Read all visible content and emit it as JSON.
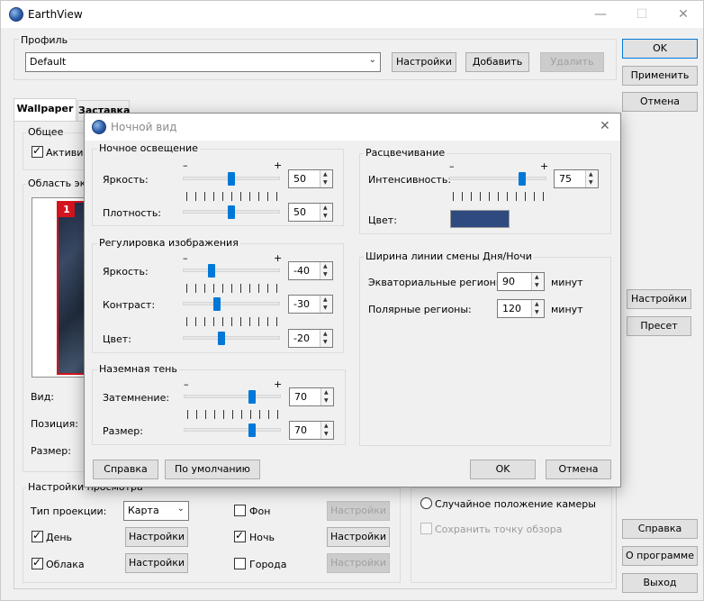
{
  "app": {
    "title": "EarthView"
  },
  "main": {
    "profile_group": "Профиль",
    "profile_value": "Default",
    "btn_settings": "Настройки",
    "btn_add": "Добавить",
    "btn_delete": "Удалить",
    "right_buttons": {
      "ok": "OK",
      "apply": "Применить",
      "cancel": "Отмена",
      "help": "Справка",
      "about": "О программе",
      "exit": "Выход"
    },
    "tabs": [
      "Wallpaper",
      "Заставка"
    ],
    "general_group": "Общее",
    "activate_label": "Активир",
    "screen_area_group": "Область экр",
    "preview_badge": "1",
    "view_label": "Вид:",
    "position_label": "Позиция:",
    "size_label": "Размер:",
    "side_settings": "Настройки",
    "side_preset": "Пресет",
    "view_settings_group": "Настройки просмотра",
    "projection_label": "Тип проекции:",
    "projection_value": "Карта",
    "day_label": "День",
    "clouds_label": "Облака",
    "bg_label": "Фон",
    "night_label": "Ночь",
    "cities_label": "Города",
    "settings_btn": "Настройки",
    "random_camera": "Случайное положение камеры",
    "save_viewpoint": "Сохранить точку обзора"
  },
  "dialog": {
    "title": "Ночной вид",
    "night_light": {
      "group": "Ночное освещение",
      "brightness_label": "Яркость:",
      "brightness": "50",
      "density_label": "Плотность:",
      "density": "50"
    },
    "image_adjust": {
      "group": "Регулировка изображения",
      "brightness_label": "Яркость:",
      "brightness": "-40",
      "contrast_label": "Контраст:",
      "contrast": "-30",
      "color_label": "Цвет:",
      "color": "-20"
    },
    "ground_shadow": {
      "group": "Наземная тень",
      "dimming_label": "Затемнение:",
      "dimming": "70",
      "size_label": "Размер:",
      "size": "70"
    },
    "coloring": {
      "group": "Расцвечивание",
      "intensity_label": "Интенсивность:",
      "intensity": "75",
      "color_label": "Цвет:",
      "swatch_color": "#2e4a7e"
    },
    "terminator": {
      "group": "Ширина линии смены Дня/Ночи",
      "equatorial_label": "Экваториальные регионы:",
      "equatorial": "90",
      "polar_label": "Полярные регионы:",
      "polar": "120",
      "unit": "минут"
    },
    "minus": "–",
    "plus": "+",
    "btn_help": "Справка",
    "btn_default": "По умолчанию",
    "btn_ok": "OK",
    "btn_cancel": "Отмена"
  },
  "sliders": {
    "nl_brightness": 0.5,
    "nl_density": 0.5,
    "ia_brightness": 0.3,
    "ia_contrast": 0.35,
    "ia_color": 0.4,
    "gs_dimming": 0.7,
    "gs_size": 0.7,
    "col_intensity": 0.75
  },
  "icons": {
    "app": "globe-icon",
    "minimize": "minimize-icon",
    "maximize": "maximize-icon",
    "close": "close-icon"
  }
}
